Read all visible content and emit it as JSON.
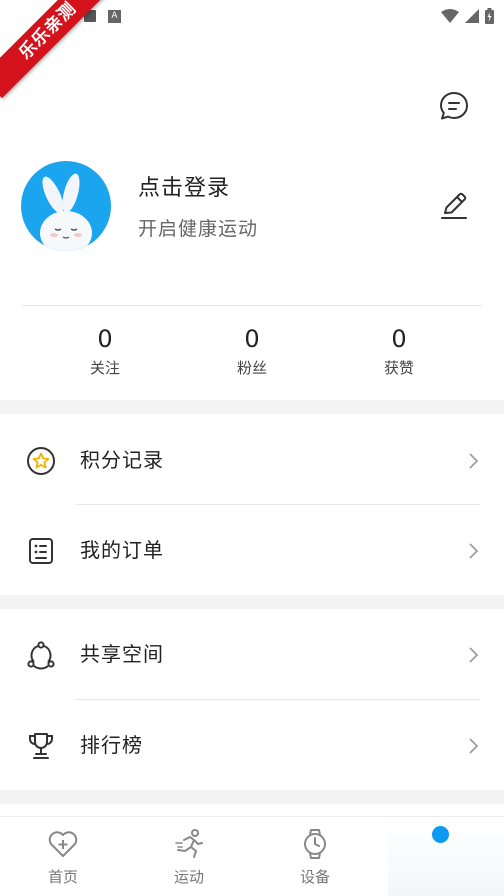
{
  "watermark": "乐乐亲测",
  "status_bar": {
    "a_icon": "A"
  },
  "header": {
    "message_icon": "message-circle-icon"
  },
  "profile": {
    "login_text": "点击登录",
    "subtitle": "开启健康运动",
    "edit_icon": "edit-pen-icon"
  },
  "stats": [
    {
      "value": "0",
      "label": "关注"
    },
    {
      "value": "0",
      "label": "粉丝"
    },
    {
      "value": "0",
      "label": "获赞"
    }
  ],
  "menu": {
    "points": {
      "label": "积分记录",
      "icon": "star-circle-icon"
    },
    "orders": {
      "label": "我的订单",
      "icon": "order-list-icon"
    },
    "shared_space": {
      "label": "共享空间",
      "icon": "share-nodes-icon"
    },
    "ranking": {
      "label": "排行榜",
      "icon": "trophy-icon"
    }
  },
  "tabs": [
    {
      "label": "首页",
      "icon": "heart-plus-icon"
    },
    {
      "label": "运动",
      "icon": "runner-icon"
    },
    {
      "label": "设备",
      "icon": "watch-icon"
    },
    {
      "label": "",
      "icon": "me-icon"
    }
  ],
  "colors": {
    "accent": "#0c9bf0",
    "ribbon": "#d4121b",
    "avatar_bg": "#1aa5ee"
  }
}
